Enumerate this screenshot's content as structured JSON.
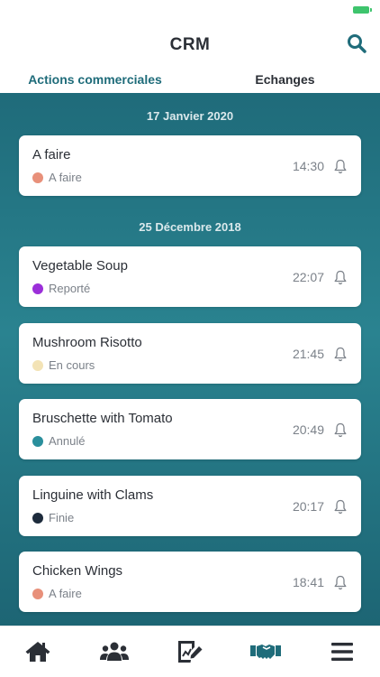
{
  "app": {
    "title": "CRM"
  },
  "tabs": [
    {
      "label": "Actions commerciales",
      "active": true
    },
    {
      "label": "Echanges",
      "active": false
    }
  ],
  "groups": [
    {
      "date": "17 Janvier 2020",
      "items": [
        {
          "title": "A faire",
          "status": "A faire",
          "status_color": "#e8907a",
          "time": "14:30"
        }
      ]
    },
    {
      "date": "25 Décembre 2018",
      "items": [
        {
          "title": "Vegetable Soup",
          "status": "Reporté",
          "status_color": "#9b2fd9",
          "time": "22:07"
        },
        {
          "title": "Mushroom Risotto",
          "status": "En cours",
          "status_color": "#f3e3b6",
          "time": "21:45"
        },
        {
          "title": "Bruschette with Tomato",
          "status": "Annulé",
          "status_color": "#2a8f9c",
          "time": "20:49"
        },
        {
          "title": "Linguine with Clams",
          "status": "Finie",
          "status_color": "#1d2b3c",
          "time": "20:17"
        },
        {
          "title": "Chicken Wings",
          "status": "A faire",
          "status_color": "#e8907a",
          "time": "18:41"
        }
      ]
    }
  ],
  "bottom_nav": [
    {
      "icon": "home-icon",
      "active": false
    },
    {
      "icon": "users-icon",
      "active": false
    },
    {
      "icon": "chart-edit-icon",
      "active": false
    },
    {
      "icon": "handshake-icon",
      "active": true
    },
    {
      "icon": "menu-icon",
      "active": false
    }
  ],
  "colors": {
    "accent": "#1f6c7a",
    "nav_icon": "#2b2f36",
    "nav_active": "#1f6c7a"
  }
}
